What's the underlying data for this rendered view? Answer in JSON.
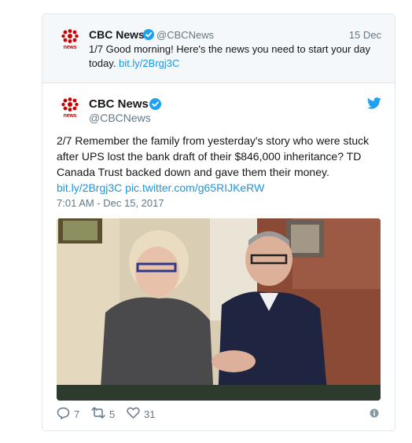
{
  "parent_tweet": {
    "name": "CBC News",
    "handle": "@CBCNews",
    "date": "15 Dec",
    "text_before": "1/7 Good morning! Here's the news you need to start your day today.",
    "link": "bit.ly/2Brgj3C",
    "logo_word": "news"
  },
  "main_tweet": {
    "name": "CBC News",
    "handle": "@CBCNews",
    "text": "2/7 Remember the family from yesterday's story who were stuck after UPS lost the bank draft of their $846,000 inheritance? TD Canada Trust backed down and gave them their money.",
    "link1": "bit.ly/2Brgj3C",
    "link2": "pic.twitter.com/g65RIJKeRW",
    "timestamp": "7:01 AM - Dec 15, 2017",
    "logo_word": "news",
    "reply_count": "7",
    "retweet_count": "5",
    "like_count": "31"
  },
  "colors": {
    "link": "#1b95e0",
    "verified": "#1da1f2",
    "cbc_red": "#cc0000",
    "muted": "#657786"
  },
  "icons": [
    "cbc-gem-icon",
    "verified-badge-icon",
    "twitter-bird-icon",
    "reply-icon",
    "retweet-icon",
    "like-icon",
    "info-icon"
  ]
}
